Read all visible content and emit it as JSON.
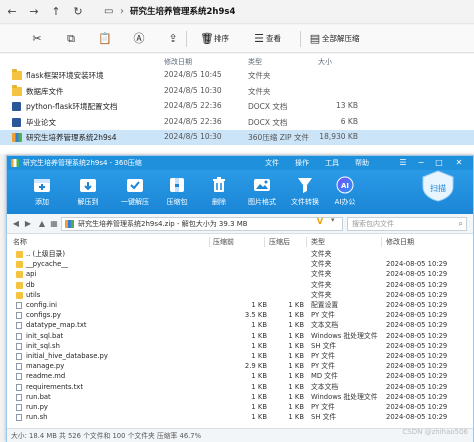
{
  "explorer": {
    "path": "研究生培养管理系统2h9s4",
    "commands": {
      "sort": "排序",
      "view": "查看",
      "extract_all": "全部解压缩"
    },
    "columns": {
      "date": "修改日期",
      "type": "类型",
      "size": "大小"
    },
    "rows": [
      {
        "name": "flask框架环境安装环境",
        "date": "2024/8/5 10:45",
        "type": "文件夹",
        "size": "",
        "icon": "folder"
      },
      {
        "name": "数据库文件",
        "date": "2024/8/5 10:30",
        "type": "文件夹",
        "size": "",
        "icon": "folder"
      },
      {
        "name": "python-flask环境配置文档",
        "date": "2024/8/5 22:36",
        "type": "DOCX 文档",
        "size": "13 KB",
        "icon": "docx"
      },
      {
        "name": "毕业论文",
        "date": "2024/8/5 22:36",
        "type": "DOCX 文档",
        "size": "6 KB",
        "icon": "docx"
      },
      {
        "name": "研究生培养管理系统2h9s4",
        "date": "2024/8/5 10:30",
        "type": "360压缩 ZIP 文件",
        "size": "18,930 KB",
        "icon": "zip",
        "selected": true
      }
    ]
  },
  "zip": {
    "title": "研究生培养管理系统2h9s4 - 360压缩",
    "menu": [
      "文件",
      "操作",
      "工具",
      "帮助"
    ],
    "toolbar": [
      {
        "label": "添加",
        "icon": "add-icon",
        "color": "#2196f3"
      },
      {
        "label": "解压到",
        "icon": "extract-icon",
        "color": "#2196f3"
      },
      {
        "label": "一键解压",
        "icon": "one-click-extract-icon",
        "color": "#2196f3"
      },
      {
        "label": "压缩包",
        "icon": "archive-icon",
        "color": "#2196f3"
      },
      {
        "label": "删除",
        "icon": "trash-icon",
        "color": "#2196f3"
      },
      {
        "label": "图片格式",
        "icon": "image-format-icon",
        "color": "#2196f3"
      },
      {
        "label": "文件转换",
        "icon": "convert-icon",
        "color": "#2196f3"
      },
      {
        "label": "AI办公",
        "icon": "ai-icon",
        "color": "#7c4dff"
      }
    ],
    "scan_label": "扫描",
    "address": "研究生培养管理系统2h9s4.zip - 解包大小为 39.3 MB",
    "search_placeholder": "搜索包内文件",
    "columns": {
      "name": "名称",
      "size": "压缩前",
      "compressed": "压缩后",
      "type": "类型",
      "date": "修改日期"
    },
    "files": [
      {
        "name": ".. (上级目录)",
        "size": "",
        "compressed": "",
        "type": "文件夹",
        "date": "",
        "icon": "up"
      },
      {
        "name": "__pycache__",
        "size": "",
        "compressed": "",
        "type": "文件夹",
        "date": "2024-08-05 10:29",
        "icon": "folder"
      },
      {
        "name": "api",
        "size": "",
        "compressed": "",
        "type": "文件夹",
        "date": "2024-08-05 10:29",
        "icon": "folder"
      },
      {
        "name": "db",
        "size": "",
        "compressed": "",
        "type": "文件夹",
        "date": "2024-08-05 10:29",
        "icon": "folder"
      },
      {
        "name": "utils",
        "size": "",
        "compressed": "",
        "type": "文件夹",
        "date": "2024-08-05 10:29",
        "icon": "folder"
      },
      {
        "name": "config.ini",
        "size": "1 KB",
        "compressed": "1 KB",
        "type": "配置设置",
        "date": "2024-08-05 10:29",
        "icon": "file"
      },
      {
        "name": "configs.py",
        "size": "3.5 KB",
        "compressed": "1 KB",
        "type": "PY 文件",
        "date": "2024-08-05 10:29",
        "icon": "file"
      },
      {
        "name": "datatype_map.txt",
        "size": "1 KB",
        "compressed": "1 KB",
        "type": "文本文档",
        "date": "2024-08-05 10:29",
        "icon": "file"
      },
      {
        "name": "init_sql.bat",
        "size": "1 KB",
        "compressed": "1 KB",
        "type": "Windows 批处理文件",
        "date": "2024-08-05 10:29",
        "icon": "file"
      },
      {
        "name": "init_sql.sh",
        "size": "1 KB",
        "compressed": "1 KB",
        "type": "SH 文件",
        "date": "2024-08-05 10:29",
        "icon": "file"
      },
      {
        "name": "initial_hive_database.py",
        "size": "1 KB",
        "compressed": "1 KB",
        "type": "PY 文件",
        "date": "2024-08-05 10:29",
        "icon": "file"
      },
      {
        "name": "manage.py",
        "size": "2.9 KB",
        "compressed": "1 KB",
        "type": "PY 文件",
        "date": "2024-08-05 10:29",
        "icon": "file"
      },
      {
        "name": "readme.md",
        "size": "1 KB",
        "compressed": "1 KB",
        "type": "MD 文件",
        "date": "2024-08-05 10:29",
        "icon": "file"
      },
      {
        "name": "requirements.txt",
        "size": "1 KB",
        "compressed": "1 KB",
        "type": "文本文档",
        "date": "2024-08-05 10:29",
        "icon": "file"
      },
      {
        "name": "run.bat",
        "size": "1 KB",
        "compressed": "1 KB",
        "type": "Windows 批处理文件",
        "date": "2024-08-05 10:29",
        "icon": "file"
      },
      {
        "name": "run.py",
        "size": "1 KB",
        "compressed": "1 KB",
        "type": "PY 文件",
        "date": "2024-08-05 10:29",
        "icon": "file"
      },
      {
        "name": "run.sh",
        "size": "1 KB",
        "compressed": "1 KB",
        "type": "SH 文件",
        "date": "2024-08-05 10:29",
        "icon": "file"
      }
    ],
    "status": "大小: 18.4 MB 共 526 个文件和 100 个文件夹 压缩率 46.7%"
  },
  "watermark": "CSDN @zhihao506"
}
